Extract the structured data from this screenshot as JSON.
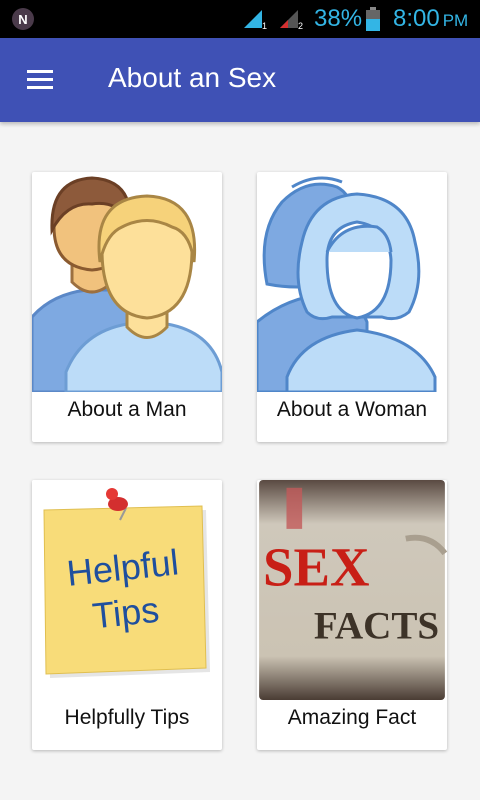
{
  "status_bar": {
    "app_icon_letter": "N",
    "sim1": "1",
    "sim2": "2",
    "battery": "38%",
    "time": "8:00",
    "ampm": "PM",
    "color": "#33b5e5"
  },
  "app_bar": {
    "title": "About an Sex",
    "color": "#3f51b5"
  },
  "cards": [
    {
      "label": "About a Man",
      "icon": "men-icon"
    },
    {
      "label": "About a Woman",
      "icon": "women-icon"
    },
    {
      "label": "Helpfully Tips",
      "icon": "helpful-tips-note",
      "image_text": [
        "Helpful",
        "Tips"
      ]
    },
    {
      "label": "Amazing Fact",
      "icon": "sex-facts-image",
      "image_text": [
        "SEX",
        "FACTS"
      ]
    }
  ]
}
